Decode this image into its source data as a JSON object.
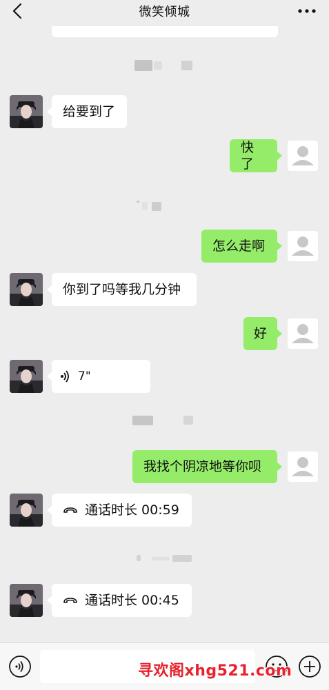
{
  "header": {
    "title": "微笑倾城",
    "back_icon": "chevron-left-icon",
    "more_icon": "more-dots-icon"
  },
  "messages": [
    {
      "from": "contact",
      "text": "给要到了"
    },
    {
      "from": "me",
      "text": "快了"
    },
    {
      "from": "me",
      "text": "怎么走啊"
    },
    {
      "from": "contact",
      "text": "你到了吗等我几分钟"
    },
    {
      "from": "me",
      "text": "好"
    },
    {
      "from": "contact",
      "type": "voice",
      "text": "7\""
    },
    {
      "from": "me",
      "text": "我找个阴凉地等你呗"
    },
    {
      "from": "contact",
      "type": "call",
      "text": "通话时长 00:59"
    },
    {
      "from": "contact",
      "type": "call",
      "text": "通话时长 00:45"
    }
  ],
  "composer": {
    "voice_icon": "voice-mode-icon",
    "emoji_icon": "emoji-icon",
    "plus_icon": "plus-icon"
  },
  "watermark": "寻欢阁xhg521.com",
  "colors": {
    "background": "#ededed",
    "outgoing_bubble": "#95ec69",
    "incoming_bubble": "#ffffff",
    "watermark": "#e8222d"
  }
}
